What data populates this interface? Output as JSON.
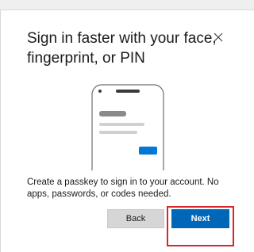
{
  "dialog": {
    "title": "Sign in faster with your face, fingerprint, or PIN",
    "description": "Create a passkey to sign in to your account. No apps, passwords, or codes needed.",
    "close_icon": "close-icon"
  },
  "illustration": {
    "icon": "phone-illustration",
    "accent_color": "#0078d4",
    "line_color": "#d0d0d0",
    "header_bar_color": "#8a8a8a"
  },
  "buttons": {
    "back_label": "Back",
    "next_label": "Next"
  },
  "annotation": {
    "highlight_color": "#d9262b"
  },
  "colors": {
    "primary": "#0067b8",
    "secondary_button": "#d6d6d6"
  }
}
